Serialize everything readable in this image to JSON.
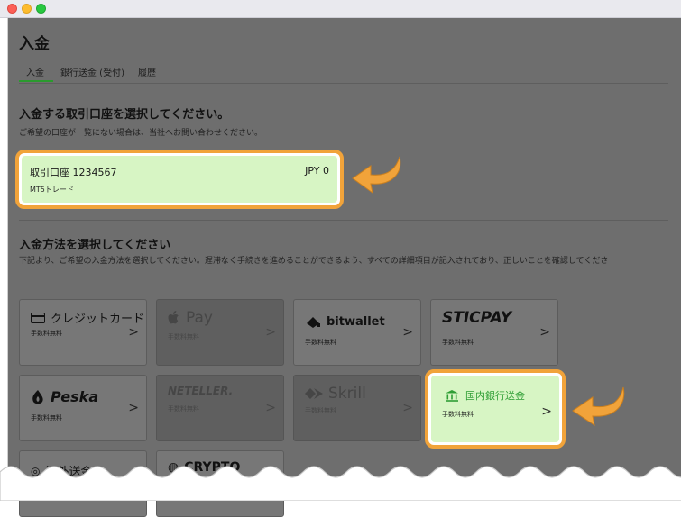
{
  "window": {
    "title": ""
  },
  "page": {
    "title": "入金"
  },
  "tabs": [
    {
      "label": "入金"
    },
    {
      "label": "銀行送金 (受付)"
    },
    {
      "label": "履歴"
    }
  ],
  "account_section": {
    "title": "入金する取引口座を選択してください。",
    "description": "ご希望の口座が一覧にない場合は、当社へお問い合わせください。"
  },
  "account": {
    "name": "取引口座 1234567",
    "type": "MT5トレード",
    "balance": "JPY 0"
  },
  "method_section": {
    "title": "入金方法を選択してください",
    "description": "下記より、ご希望の入金方法を選択してください。遅滞なく手続きを進めることができるよう、すべての詳細項目が記入されており、正しいことを確認してくださ"
  },
  "methods": [
    {
      "name": "クレジットカード",
      "fee": "手数料無料",
      "icon": "credit-card-icon"
    },
    {
      "name": "Pay",
      "fee": "手数料無料",
      "icon": "apple-icon"
    },
    {
      "name": "bitwallet",
      "fee": "手数料無料",
      "icon": "bitwallet-icon"
    },
    {
      "name": "STICPAY",
      "fee": "手数料無料"
    },
    {
      "name": "Peska",
      "fee": "手数料無料",
      "icon": "peska-icon"
    },
    {
      "name": "NETELLER.",
      "fee": "手数料無料"
    },
    {
      "name": "Skrill",
      "fee": "手数料無料",
      "icon": "skrill-icon"
    },
    {
      "name": "国内銀行送金",
      "fee": "手数料無料",
      "icon": "bank-icon"
    },
    {
      "name": "海外送金",
      "icon": "globe-icon"
    },
    {
      "name": "CRYPTO",
      "icon": "crypto-icon"
    }
  ],
  "chevron": ">",
  "colors": {
    "highlight_border": "#f1a33a",
    "highlight_fill": "#d7f5c4",
    "accent_green": "#2a9a2e"
  }
}
